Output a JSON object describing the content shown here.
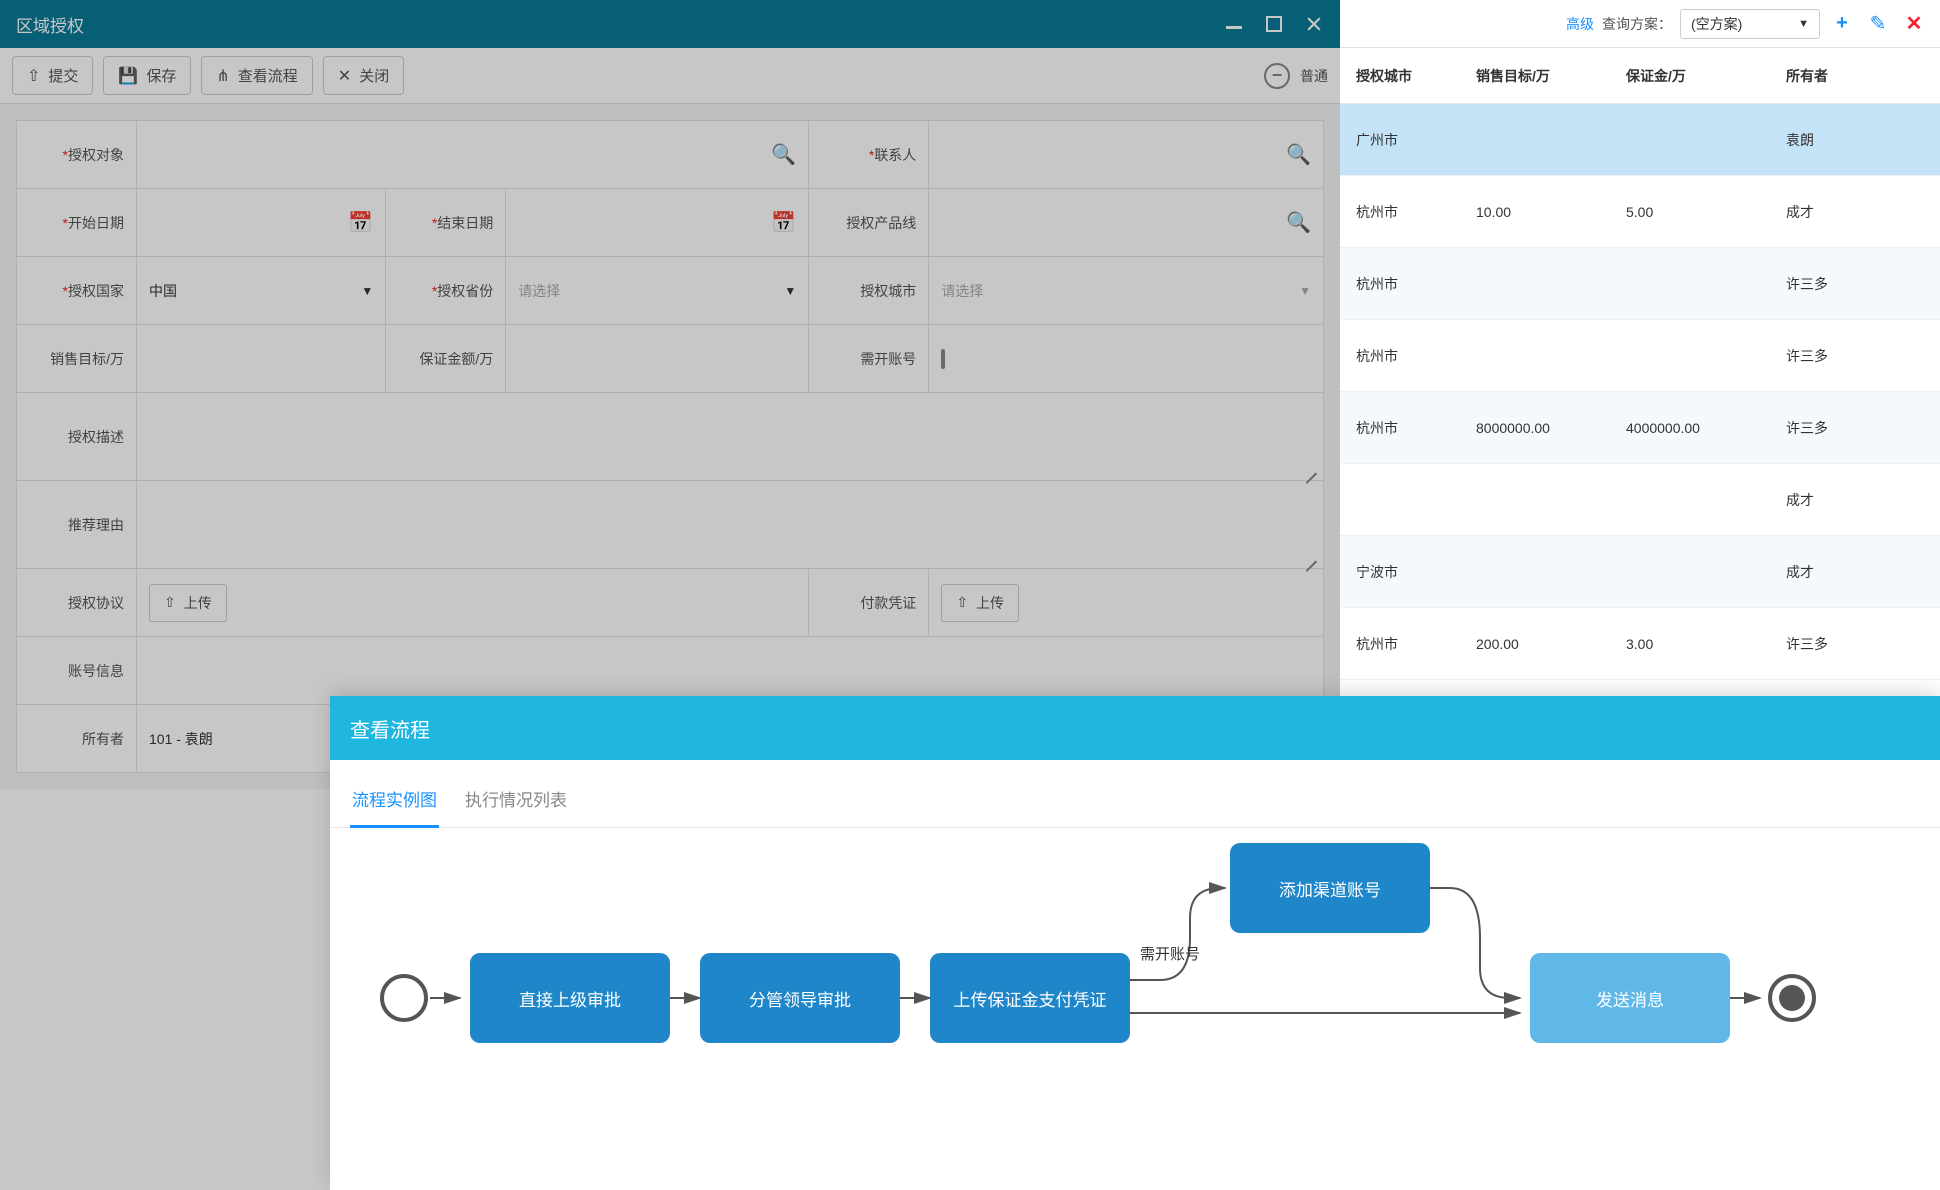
{
  "bgHeader": {
    "advanced": "高级",
    "planLabel": "查询方案：",
    "planValue": "(空方案)"
  },
  "bgColumns": {
    "city": "授权城市",
    "sales": "销售目标/万",
    "deposit": "保证金/万",
    "owner": "所有者"
  },
  "bgRows": [
    {
      "city": "广州市",
      "sales": "",
      "deposit": "",
      "owner": "袁朗",
      "sel": true
    },
    {
      "city": "杭州市",
      "sales": "10.00",
      "deposit": "5.00",
      "owner": "成才"
    },
    {
      "city": "杭州市",
      "sales": "",
      "deposit": "",
      "owner": "许三多",
      "alt": true
    },
    {
      "city": "杭州市",
      "sales": "",
      "deposit": "",
      "owner": "许三多"
    },
    {
      "city": "杭州市",
      "sales": "8000000.00",
      "deposit": "4000000.00",
      "owner": "许三多",
      "alt": true
    },
    {
      "city": "",
      "sales": "",
      "deposit": "",
      "owner": "成才"
    },
    {
      "city": "宁波市",
      "sales": "",
      "deposit": "",
      "owner": "成才",
      "alt": true
    },
    {
      "city": "杭州市",
      "sales": "200.00",
      "deposit": "3.00",
      "owner": "许三多"
    }
  ],
  "modal": {
    "title": "区域授权",
    "toolbar": {
      "submit": "提交",
      "save": "保存",
      "viewFlow": "查看流程",
      "close": "关闭",
      "normal": "普通"
    },
    "labels": {
      "authObj": "授权对象",
      "contact": "联系人",
      "startDate": "开始日期",
      "endDate": "结束日期",
      "productLine": "授权产品线",
      "country": "授权国家",
      "province": "授权省份",
      "city": "授权城市",
      "salesTarget": "销售目标/万",
      "deposit": "保证金额/万",
      "needAccount": "需开账号",
      "desc": "授权描述",
      "reason": "推荐理由",
      "agreement": "授权协议",
      "payment": "付款凭证",
      "accountInfo": "账号信息",
      "owner": "所有者"
    },
    "values": {
      "country": "中国",
      "provincePlaceholder": "请选择",
      "cityPlaceholder": "请选择",
      "upload": "上传",
      "owner": "101 - 袁朗"
    }
  },
  "flow": {
    "title": "查看流程",
    "tabs": {
      "diagram": "流程实例图",
      "list": "执行情况列表"
    },
    "branchLabel": "需开账号",
    "nodes": {
      "n1": "直接上级审批",
      "n2": "分管领导审批",
      "n3": "上传保证金支付凭证",
      "n4": "添加渠道账号",
      "n5": "发送消息"
    }
  }
}
